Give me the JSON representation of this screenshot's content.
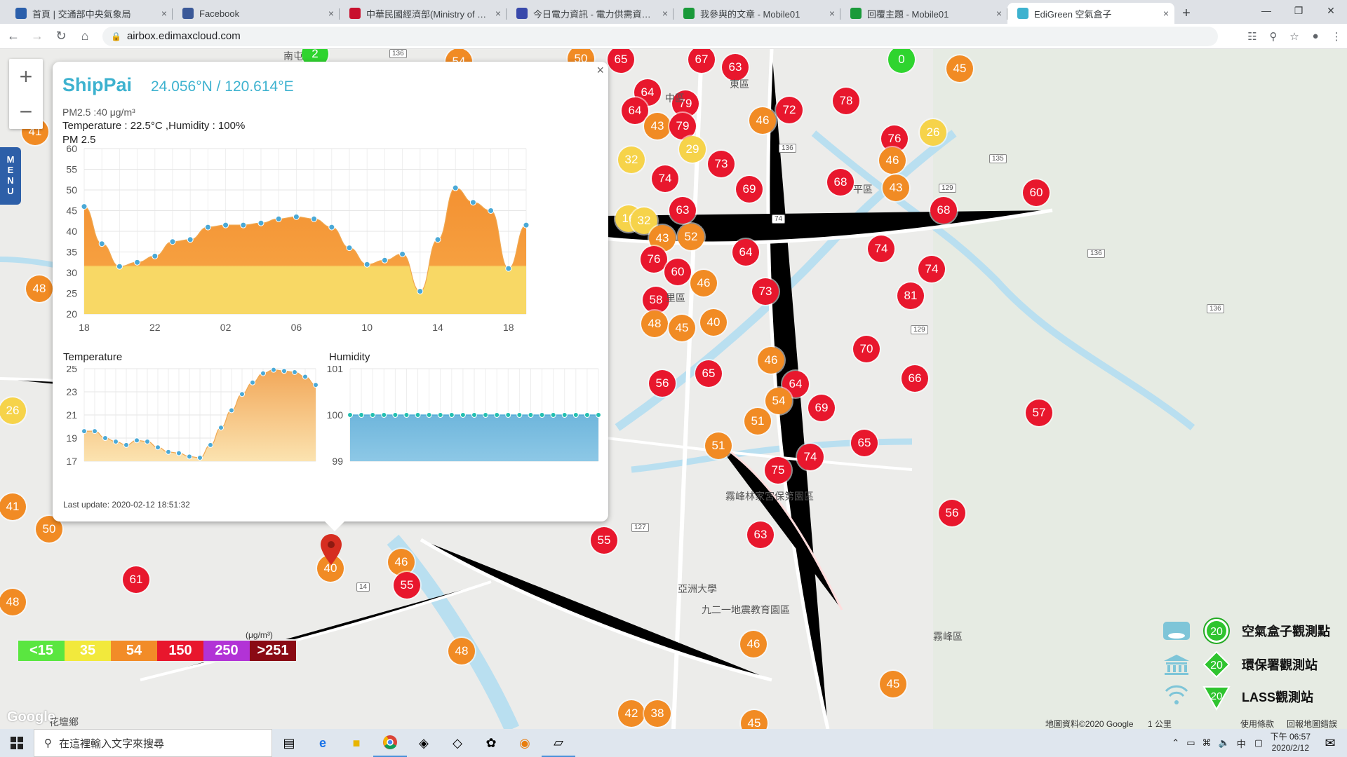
{
  "tabs": [
    {
      "title": "首頁 | 交通部中央氣象局",
      "icon": "eye-icon",
      "color": "#2b5fab"
    },
    {
      "title": "Facebook",
      "icon": "facebook-icon",
      "color": "#3b5998"
    },
    {
      "title": "中華民國經濟部(Ministry of Econ",
      "icon": "flag-icon",
      "color": "#c8102e"
    },
    {
      "title": "今日電力資訊 - 電力供需資訊 - 台",
      "icon": "power-icon",
      "color": "#3949ab"
    },
    {
      "title": "我參與的文章 - Mobile01",
      "icon": "mobile01-icon",
      "color": "#1a9a3a"
    },
    {
      "title": "回覆主題 - Mobile01",
      "icon": "mobile01-icon",
      "color": "#1a9a3a"
    },
    {
      "title": "EdiGreen 空氣盒子",
      "icon": "edigreen-icon",
      "color": "#3db2cf"
    }
  ],
  "url": "airbox.edimaxcloud.com",
  "popup": {
    "name": "ShipPai",
    "coord": "24.056°N / 120.614°E",
    "pm_line": "PM2.5 :40 μg/m³",
    "env_line": "Temperature : 22.5°C ,Humidity : 100%",
    "pm_title": "PM 2.5",
    "temp_title": "Temperature",
    "hum_title": "Humidity",
    "last_update": "Last update: 2020-02-12 18:51:32",
    "close": "×"
  },
  "chart_data": [
    {
      "type": "area",
      "title": "PM 2.5",
      "x": [
        "18",
        "",
        "",
        "",
        "22",
        "",
        "",
        "",
        "02",
        "",
        "",
        "",
        "06",
        "",
        "",
        "",
        "10",
        "",
        "",
        "",
        "14",
        "",
        "",
        "",
        "18"
      ],
      "values": [
        46,
        37,
        31.5,
        32.5,
        34,
        37.5,
        38,
        41,
        41.5,
        41.5,
        42,
        43,
        43.5,
        43,
        41,
        36,
        32,
        33,
        34.5,
        25.5,
        38,
        50.5,
        47,
        45,
        31,
        41.5
      ],
      "xticks": [
        "18",
        "22",
        "02",
        "06",
        "10",
        "14",
        "18"
      ],
      "ylim": [
        20,
        60
      ],
      "yticks": [
        20,
        25,
        30,
        35,
        40,
        45,
        50,
        55,
        60
      ],
      "colors": {
        "high": "#f59a3a",
        "low": "#f8d865"
      },
      "threshold": 35
    },
    {
      "type": "area",
      "title": "Temperature",
      "values": [
        19.6,
        19.6,
        19.0,
        18.7,
        18.4,
        18.8,
        18.7,
        18.2,
        17.8,
        17.7,
        17.4,
        17.3,
        18.4,
        19.9,
        21.4,
        22.8,
        23.8,
        24.6,
        24.9,
        24.8,
        24.7,
        24.3,
        23.6
      ],
      "ylim": [
        17,
        25
      ],
      "yticks": [
        17,
        19,
        21,
        23,
        25
      ]
    },
    {
      "type": "area",
      "title": "Humidity",
      "values": [
        100,
        100,
        100,
        100,
        100,
        100,
        100,
        100,
        100,
        100,
        100,
        100,
        100,
        100,
        100,
        100,
        100,
        100,
        100,
        100,
        100,
        100,
        100
      ],
      "ylim": [
        99,
        101
      ],
      "yticks": [
        99,
        100,
        101
      ]
    }
  ],
  "legend": [
    {
      "label": "<15",
      "color": "#5ae640"
    },
    {
      "label": "35",
      "color": "#f2e93c"
    },
    {
      "label": "54",
      "color": "#f28c28"
    },
    {
      "label": "150",
      "color": "#e8172d"
    },
    {
      "label": "250",
      "color": "#b233d6"
    },
    {
      "label": ">251",
      "color": "#8a0a14"
    }
  ],
  "legend_unit": "(μg/m³)",
  "map_legend": [
    {
      "label": "空氣盒子觀測點",
      "value": "20"
    },
    {
      "label": "環保署觀測站",
      "value": "20"
    },
    {
      "label": "LASS觀測站",
      "value": "20"
    }
  ],
  "map_labels": [
    "中區",
    "東區",
    "南屯",
    "霧峰林家宮保第園區",
    "亞洲大學",
    "九二一地震教育園區",
    "霧峰區",
    "花壇鄉",
    "平區",
    "里區"
  ],
  "roads": [
    "136",
    "136",
    "135",
    "136",
    "136",
    "129",
    "129",
    "127",
    "74",
    "14"
  ],
  "markers": [
    {
      "v": "65",
      "c": "red"
    },
    {
      "v": "67",
      "c": "red"
    },
    {
      "v": "63",
      "c": "red"
    },
    {
      "v": "0",
      "c": "grn"
    },
    {
      "v": "45",
      "c": "org"
    },
    {
      "v": "64",
      "c": "red"
    },
    {
      "v": "64",
      "c": "red"
    },
    {
      "v": "43",
      "c": "org"
    },
    {
      "v": "79",
      "c": "red"
    },
    {
      "v": "79",
      "c": "red"
    },
    {
      "v": "46",
      "c": "org"
    },
    {
      "v": "72",
      "c": "red"
    },
    {
      "v": "78",
      "c": "red"
    },
    {
      "v": "32",
      "c": "yel"
    },
    {
      "v": "29",
      "c": "yel"
    },
    {
      "v": "73",
      "c": "red"
    },
    {
      "v": "76",
      "c": "red"
    },
    {
      "v": "46",
      "c": "org"
    },
    {
      "v": "26",
      "c": "yel"
    },
    {
      "v": "74",
      "c": "red"
    },
    {
      "v": "69",
      "c": "red"
    },
    {
      "v": "68",
      "c": "red"
    },
    {
      "v": "43",
      "c": "org"
    },
    {
      "v": "60",
      "c": "red"
    },
    {
      "v": "63",
      "c": "red"
    },
    {
      "v": "16",
      "c": "yel"
    },
    {
      "v": "32",
      "c": "yel"
    },
    {
      "v": "43",
      "c": "org"
    },
    {
      "v": "52",
      "c": "org"
    },
    {
      "v": "68",
      "c": "red"
    },
    {
      "v": "76",
      "c": "red"
    },
    {
      "v": "64",
      "c": "red"
    },
    {
      "v": "74",
      "c": "red"
    },
    {
      "v": "60",
      "c": "red"
    },
    {
      "v": "46",
      "c": "org"
    },
    {
      "v": "74",
      "c": "red"
    },
    {
      "v": "73",
      "c": "red"
    },
    {
      "v": "81",
      "c": "red"
    },
    {
      "v": "58",
      "c": "red"
    },
    {
      "v": "48",
      "c": "org"
    },
    {
      "v": "45",
      "c": "org"
    },
    {
      "v": "40",
      "c": "org"
    },
    {
      "v": "70",
      "c": "red"
    },
    {
      "v": "46",
      "c": "org"
    },
    {
      "v": "56",
      "c": "red"
    },
    {
      "v": "65",
      "c": "red"
    },
    {
      "v": "64",
      "c": "red"
    },
    {
      "v": "66",
      "c": "red"
    },
    {
      "v": "54",
      "c": "org"
    },
    {
      "v": "69",
      "c": "red"
    },
    {
      "v": "57",
      "c": "red"
    },
    {
      "v": "51",
      "c": "org"
    },
    {
      "v": "51",
      "c": "org"
    },
    {
      "v": "65",
      "c": "red"
    },
    {
      "v": "74",
      "c": "red"
    },
    {
      "v": "75",
      "c": "red"
    },
    {
      "v": "56",
      "c": "red"
    },
    {
      "v": "63",
      "c": "red"
    },
    {
      "v": "55",
      "c": "red"
    },
    {
      "v": "46",
      "c": "org"
    },
    {
      "v": "55",
      "c": "red"
    },
    {
      "v": "40",
      "c": "org"
    },
    {
      "v": "48",
      "c": "org"
    },
    {
      "v": "46",
      "c": "org"
    },
    {
      "v": "45",
      "c": "org"
    },
    {
      "v": "42",
      "c": "org"
    },
    {
      "v": "38",
      "c": "org"
    },
    {
      "v": "45",
      "c": "org"
    },
    {
      "v": "61",
      "c": "red"
    },
    {
      "v": "50",
      "c": "org"
    },
    {
      "v": "41",
      "c": "org"
    },
    {
      "v": "48",
      "c": "org"
    },
    {
      "v": "48",
      "c": "org"
    },
    {
      "v": "26",
      "c": "yel"
    },
    {
      "v": "41",
      "c": "org"
    },
    {
      "v": "2",
      "c": "grn"
    },
    {
      "v": "54",
      "c": "org"
    },
    {
      "v": "50",
      "c": "org"
    }
  ],
  "taskbar": {
    "search_placeholder": "在這裡輸入文字來搜尋",
    "time": "下午 06:57",
    "date": "2020/2/12",
    "ime": "中"
  },
  "attrib": {
    "data": "地圖資料©2020 Google",
    "scale": "1 公里",
    "terms": "使用條款",
    "report": "回報地圖錯誤"
  },
  "menu": "MENU"
}
